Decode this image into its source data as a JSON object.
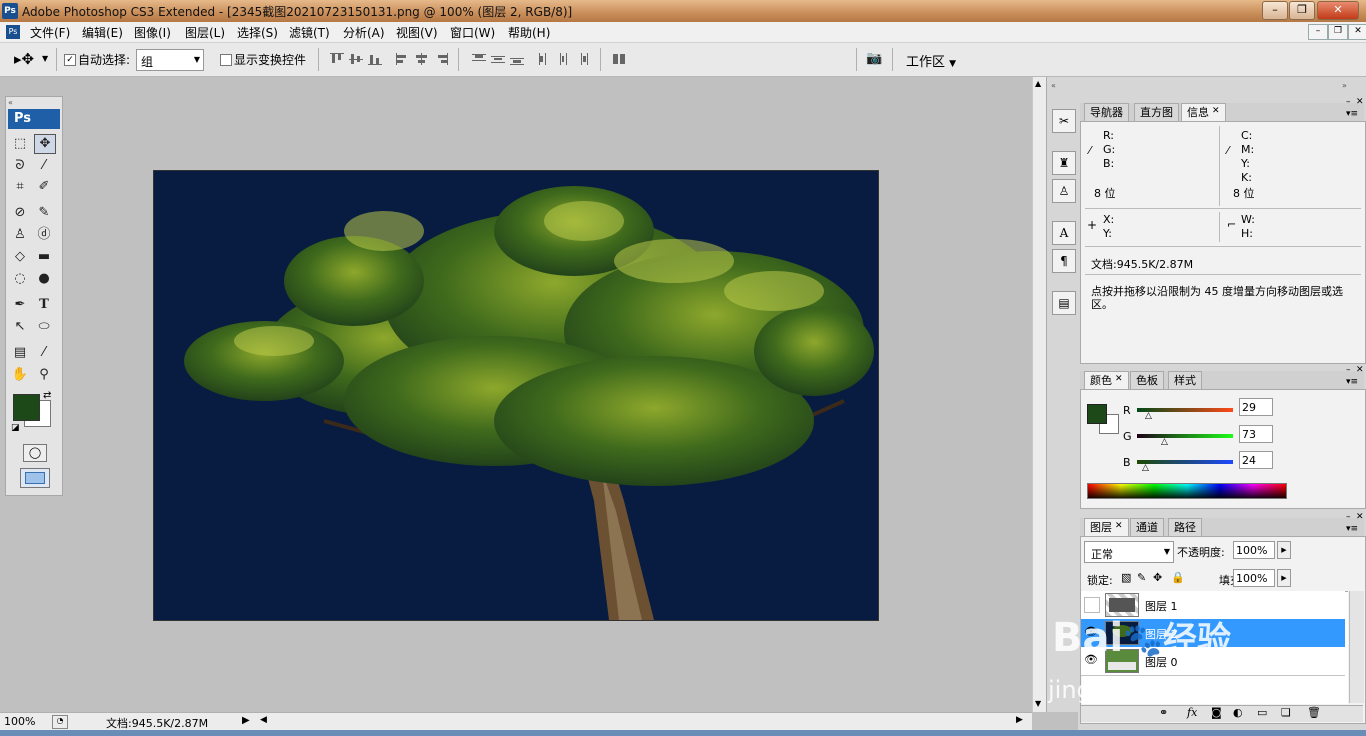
{
  "window": {
    "title": "Adobe Photoshop CS3 Extended - [2345截图20210723150131.png @ 100% (图层 2, RGB/8)]",
    "app_badge": "Ps",
    "controls": [
      "–",
      "❐",
      "✕"
    ]
  },
  "menu": {
    "items": [
      "文件(F)",
      "编辑(E)",
      "图像(I)",
      "图层(L)",
      "选择(S)",
      "滤镜(T)",
      "分析(A)",
      "视图(V)",
      "窗口(W)",
      "帮助(H)"
    ],
    "doc_controls": [
      "–",
      "❐",
      "✕"
    ]
  },
  "options": {
    "auto_select_label": "自动选择:",
    "auto_select_checked": true,
    "auto_select_value": "组",
    "show_transform_label": "显示变换控件",
    "show_transform_checked": false,
    "workspace_label": "工作区"
  },
  "tools": {
    "badge": "Ps",
    "foreground_color": "#1d4918",
    "background_color": "#ffffff"
  },
  "status": {
    "zoom": "100%",
    "doc_info": "文档:945.5K/2.87M"
  },
  "info_panel": {
    "tabs": [
      "导航器",
      "直方图",
      "信息"
    ],
    "active_tab": "信息",
    "rgb_labels": [
      "R:",
      "G:",
      "B:"
    ],
    "cmyk_labels": [
      "C:",
      "M:",
      "Y:",
      "K:"
    ],
    "bit_depth_left": "8 位",
    "bit_depth_right": "8 位",
    "xy_labels": [
      "X:",
      "Y:"
    ],
    "wh_labels": [
      "W:",
      "H:"
    ],
    "doc_info": "文档:945.5K/2.87M",
    "hint": "点按并拖移以沿限制为 45 度增量方向移动图层或选区。"
  },
  "color_panel": {
    "tabs": [
      "颜色",
      "色板",
      "样式"
    ],
    "active_tab": "颜色",
    "channels": [
      {
        "label": "R",
        "value": "29"
      },
      {
        "label": "G",
        "value": "73"
      },
      {
        "label": "B",
        "value": "24"
      }
    ],
    "swatch": "#1d4918"
  },
  "layers_panel": {
    "tabs": [
      "图层",
      "通道",
      "路径"
    ],
    "active_tab": "图层",
    "blend_mode": "正常",
    "opacity_label": "不透明度:",
    "opacity_value": "100%",
    "lock_label": "锁定:",
    "fill_label": "填充:",
    "fill_value": "100%",
    "layers": [
      {
        "name": "图层 1",
        "visible": false,
        "selected": false
      },
      {
        "name": "图层 2",
        "visible": true,
        "selected": true
      },
      {
        "name": "图层 0",
        "visible": true,
        "selected": false
      }
    ],
    "footer_icons": [
      "link-icon",
      "fx-icon",
      "mask-icon",
      "adjustment-icon",
      "group-icon",
      "new-layer-icon",
      "trash-icon"
    ]
  },
  "watermark": {
    "brand": "Bai",
    "brand2": "经验",
    "url": "jingyan.baidu.com"
  },
  "colors": {
    "canvas_bg": "#071c40",
    "selection": "#3399ff"
  }
}
